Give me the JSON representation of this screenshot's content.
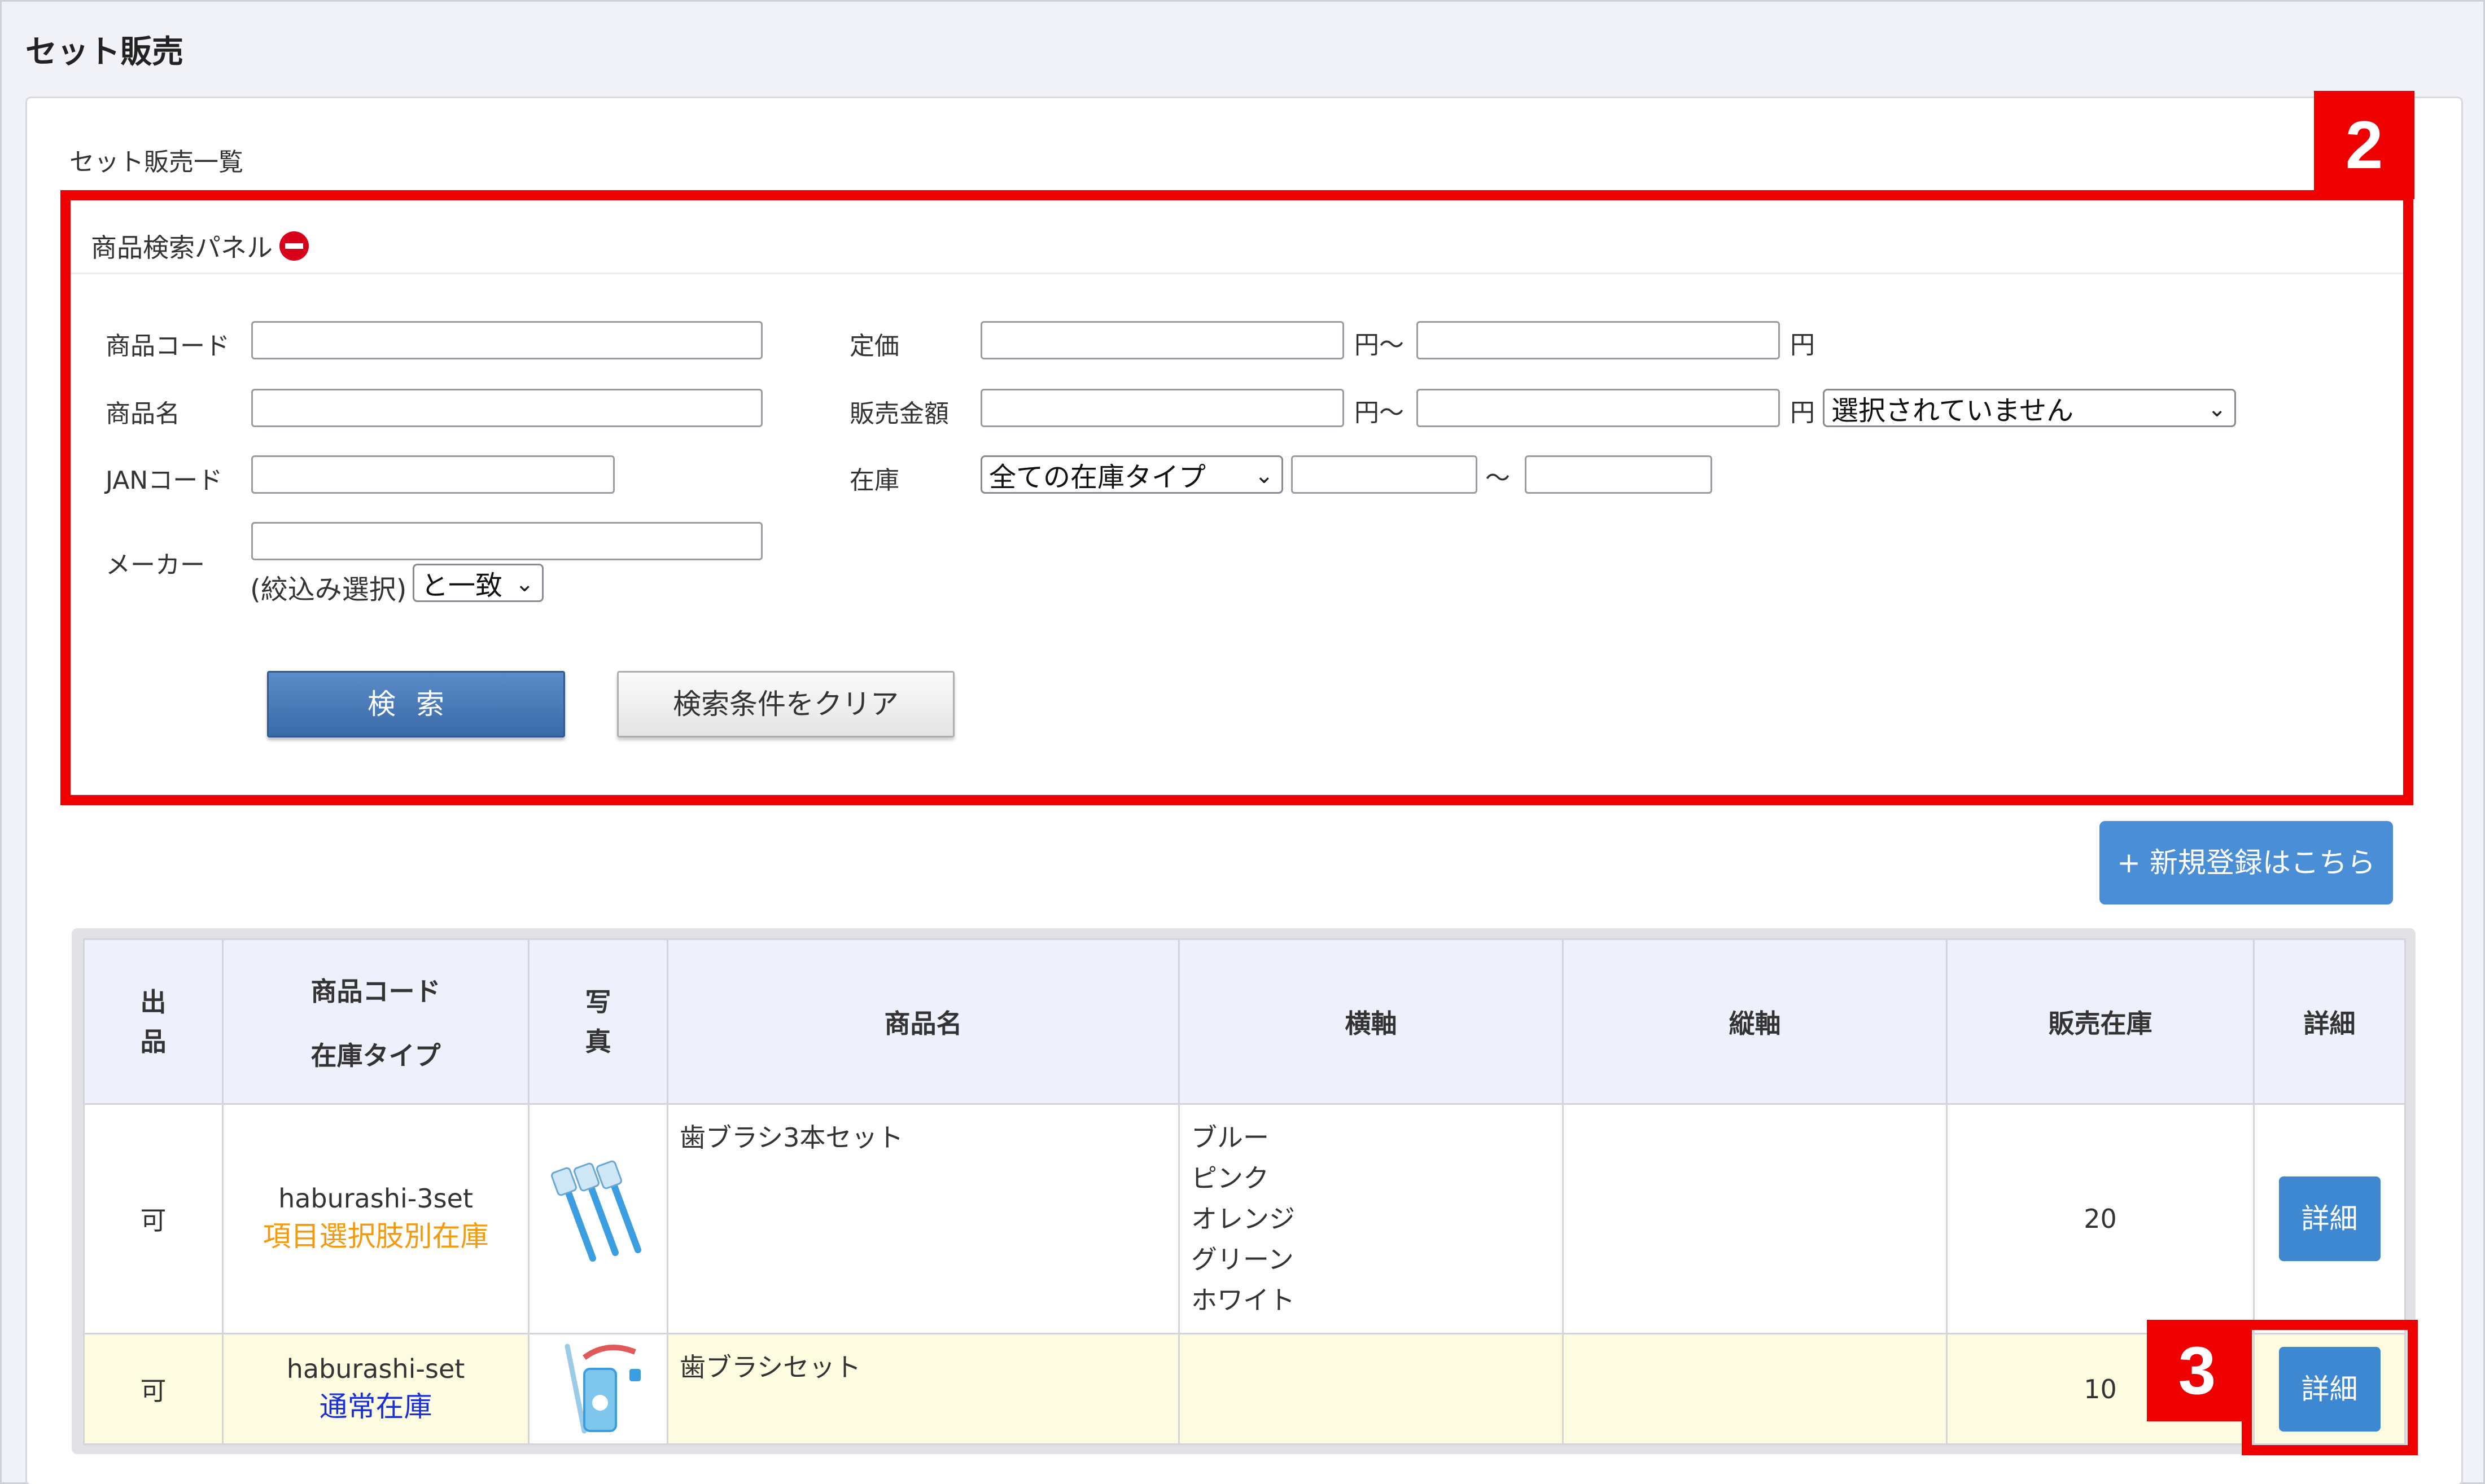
{
  "page_title": "セット販売",
  "list_title": "セット販売一覧",
  "search_panel": {
    "header": "商品検索パネル",
    "product_code_label": "商品コード",
    "product_name_label": "商品名",
    "jan_label": "JANコード",
    "maker_label": "メーカー",
    "maker_filter_label": "(絞込み選択)",
    "maker_match_value": "と一致",
    "list_price_label": "定価",
    "sale_price_label": "販売金額",
    "stock_label": "在庫",
    "yen_tilde": "円〜",
    "yen": "円",
    "tilde": "〜",
    "price_select_value": "選択されていません",
    "stock_type_value": "全ての在庫タイプ",
    "search_button": "検索",
    "clear_button": "検索条件をクリア"
  },
  "annotations": {
    "badge_2": "2",
    "badge_3": "3"
  },
  "new_button": "+ 新規登録はこちら",
  "table": {
    "headers": {
      "listing": "出品",
      "code": "商品コード",
      "stock_type": "在庫タイプ",
      "photo": "写真",
      "name": "商品名",
      "horizontal": "横軸",
      "vertical": "縦軸",
      "sale_stock": "販売在庫",
      "detail": "詳細"
    },
    "rows": [
      {
        "listing": "可",
        "code": "haburashi-3set",
        "stock_type": "項目選択肢別在庫",
        "name": "歯ブラシ3本セット",
        "horizontal": [
          "ブルー",
          "ピンク",
          "オレンジ",
          "グリーン",
          "ホワイト"
        ],
        "vertical": "",
        "sale_stock": "20",
        "detail": "詳細"
      },
      {
        "listing": "可",
        "code": "haburashi-set",
        "stock_type": "通常在庫",
        "name": "歯ブラシセット",
        "horizontal": [],
        "vertical": "",
        "sale_stock": "10",
        "detail": "詳細"
      }
    ]
  }
}
